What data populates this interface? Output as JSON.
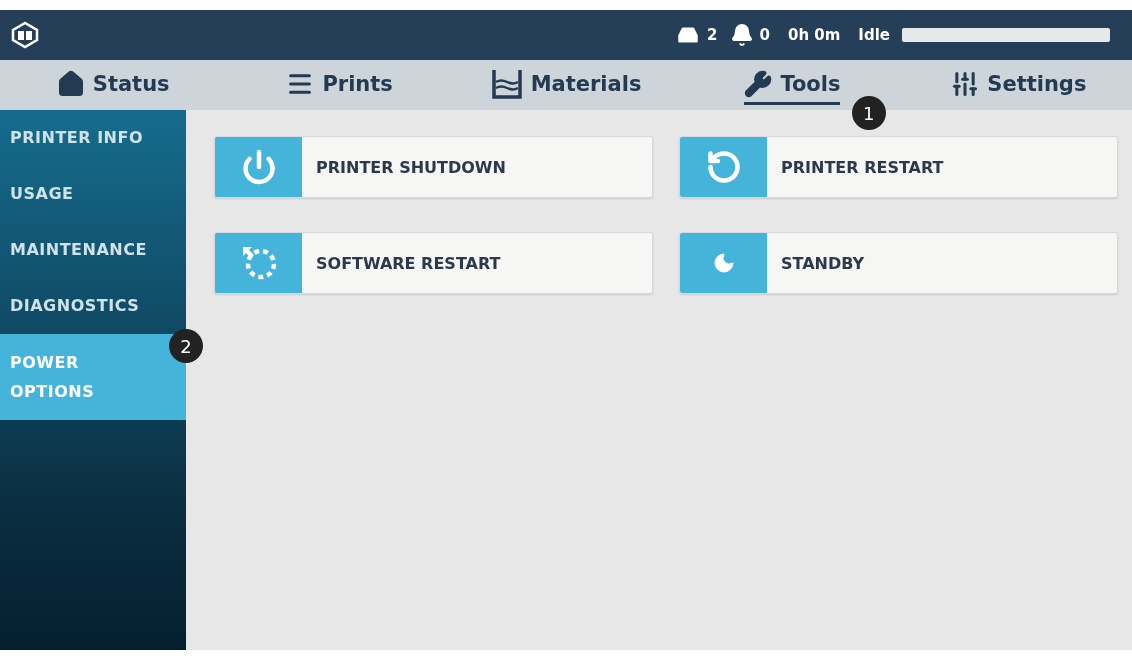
{
  "header": {
    "tray_count": "2",
    "notification_count": "0",
    "time": "0h 0m",
    "status": "Idle",
    "progress": {
      "level": 0
    }
  },
  "tabs": [
    {
      "label": "Status",
      "kind": "home",
      "selected": false
    },
    {
      "label": "Prints",
      "kind": "list",
      "selected": false
    },
    {
      "label": "Materials",
      "kind": "materials",
      "selected": false
    },
    {
      "label": "Tools",
      "kind": "wrench",
      "selected": true,
      "callout": "1"
    },
    {
      "label": "Settings",
      "kind": "sliders",
      "selected": false
    }
  ],
  "sidebar": {
    "items": [
      {
        "label": "PRINTER INFO",
        "selected": false
      },
      {
        "label": "USAGE",
        "selected": false
      },
      {
        "label": "MAINTENANCE",
        "selected": false
      },
      {
        "label": "DIAGNOSTICS",
        "selected": false
      },
      {
        "label": "POWER OPTIONS",
        "selected": true,
        "callout": "2"
      }
    ]
  },
  "actions": [
    {
      "label": "PRINTER SHUTDOWN",
      "kind": "power"
    },
    {
      "label": "PRINTER RESTART",
      "kind": "restart"
    },
    {
      "label": "SOFTWARE RESTART",
      "kind": "software"
    },
    {
      "label": "STANDBY",
      "kind": "standby"
    }
  ]
}
